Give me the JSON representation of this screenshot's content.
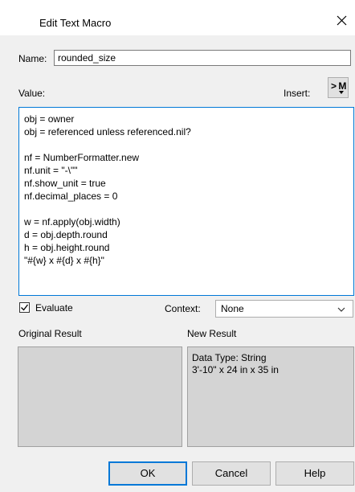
{
  "window": {
    "title": "Edit Text Macro",
    "close_icon": "close-icon"
  },
  "name": {
    "label": "Name:",
    "value": "rounded_size"
  },
  "value_section": {
    "label": "Value:",
    "insert_label": "Insert:",
    "insert_button": "> M",
    "code_lines": [
      "obj = owner",
      "obj = referenced unless referenced.nil?",
      "",
      "nf = NumberFormatter.new",
      "nf.unit = \"-\\\"\"",
      "nf.show_unit = true",
      "nf.decimal_places = 0",
      "",
      "w = nf.apply(obj.width)",
      "d = obj.depth.round",
      "h = obj.height.round",
      "\"#{w} x #{d} x #{h}\""
    ]
  },
  "options": {
    "evaluate_label": "Evaluate",
    "evaluate_checked": true,
    "context_label": "Context:",
    "context_value": "None"
  },
  "results": {
    "original_label": "Original Result",
    "new_label": "New Result",
    "original_lines": [],
    "new_lines": [
      "Data Type: String",
      "3'-10\" x 24 in x 35 in"
    ]
  },
  "buttons": {
    "ok": "OK",
    "cancel": "Cancel",
    "help": "Help"
  },
  "colors": {
    "accent": "#0078d7",
    "result_background": "#d4d4d4"
  }
}
